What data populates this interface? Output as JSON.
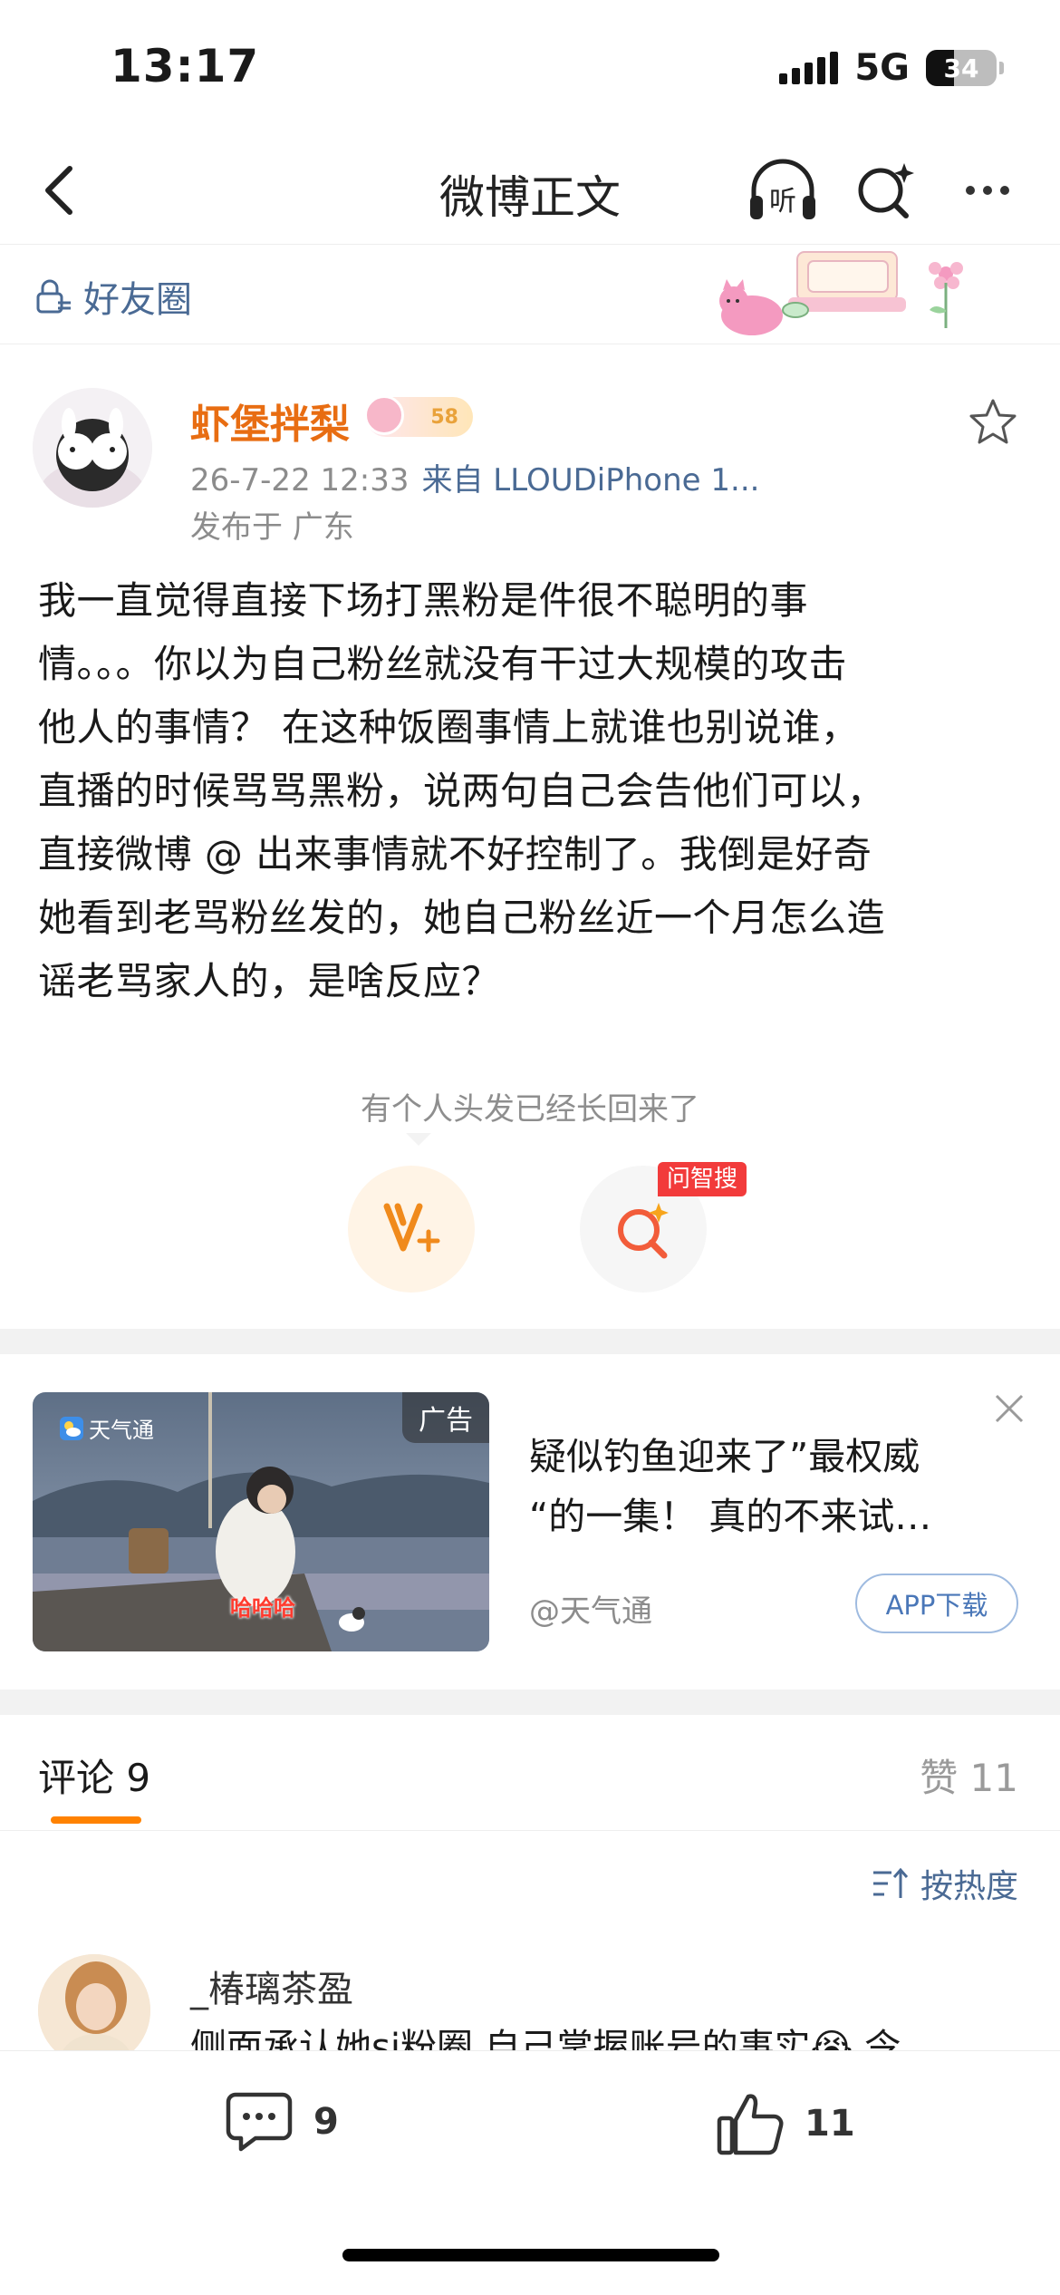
{
  "status_bar": {
    "time": "13:17",
    "network": "5G",
    "battery": "34"
  },
  "nav": {
    "title": "微博正文",
    "listen_label": "听"
  },
  "friend_bar": {
    "label": "好友圈"
  },
  "post": {
    "username": "虾堡拌梨",
    "badge": "58",
    "time": "26-7-22 12:33",
    "source": "来自 LLOUDiPhone 1...",
    "location": "发布于 广东",
    "lines": [
      "我一直觉得直接下场打黑粉是件很不聪明的事",
      "情。。。你以为自己粉丝就没有干过大规模的攻击",
      "他人的事情？ 在这种饭圈事情上就谁也别说谁，",
      "直播的时候骂骂黑粉，说两句自己会告他们可以，",
      "直接微博 @ 出来事情就不好控制了。我倒是好奇",
      "她看到老骂粉丝发的，她自己粉丝近一个月怎么造",
      "谣老骂家人的，是啥反应？"
    ]
  },
  "hint": {
    "text": "有个人头发已经长回来了",
    "ask_tag": "问智搜"
  },
  "ad": {
    "badge": "广告",
    "app_name": "天气通",
    "caption": "哈哈哈",
    "title_lines": [
      "疑似钓鱼迎来了”最权威",
      "“的一集！ 真的不来试…"
    ],
    "source": "@天气通",
    "download": "APP下载"
  },
  "comments": {
    "tab_label": "评论 9",
    "likes_label": "赞 11",
    "sort_label": "按热度",
    "items": [
      {
        "user": "_椿璃茶盈",
        "text": "侧面承认她sj粉圈 自己掌握账号的事实😭 令"
      }
    ]
  },
  "bottom_bar": {
    "comment_count": "9",
    "like_count": "11"
  },
  "colors": {
    "accent_orange": "#ff8200",
    "username_orange": "#e86d12",
    "link_blue": "#4a6a94"
  }
}
